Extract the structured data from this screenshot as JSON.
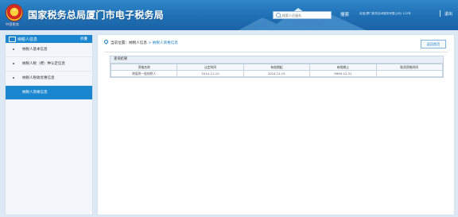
{
  "header": {
    "emblem_text": "中国税务",
    "title": "国家税务总局厦门市电子税务局",
    "search": {
      "placeholder": "搜索人员服务"
    },
    "search_label": "搜索",
    "user_info": "欢迎(厦门税务技术服务有限公司)  122号",
    "logout_label": "退出"
  },
  "sidebar": {
    "title": "纳税人信息",
    "fold_label": "折叠",
    "items": [
      {
        "label": "纳税人基本信息",
        "active": false
      },
      {
        "label": "纳税人税（费）种认定信息",
        "active": false
      },
      {
        "label": "纳税人税收优惠信息",
        "active": false
      },
      {
        "label": "纳税人资格信息",
        "active": true
      }
    ]
  },
  "main": {
    "breadcrumb": {
      "prefix": "当前位置：",
      "level1": "纳税人信息",
      "separator": " > ",
      "current": "纳税人资格信息"
    },
    "back_label": "返回首页",
    "result_title": "查询结果",
    "table": {
      "headers": [
        "资格名称",
        "认定时间",
        "有效期起",
        "有效期止",
        "取消资格时间"
      ],
      "rows": [
        [
          "增值税一般纳税人",
          "2014-11-10",
          "2014-11-01",
          "9999-12-31",
          ""
        ]
      ]
    }
  }
}
